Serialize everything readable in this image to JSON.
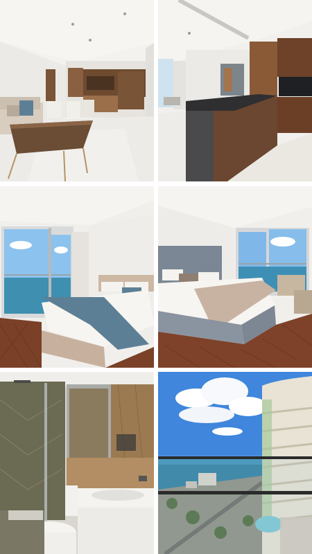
{
  "gallery": {
    "photos": [
      {
        "subject": "living-room"
      },
      {
        "subject": "kitchen"
      },
      {
        "subject": "bedroom-sea-view"
      },
      {
        "subject": "bedroom-grey-headboard"
      },
      {
        "subject": "bathroom"
      },
      {
        "subject": "balcony-sea-view"
      }
    ]
  },
  "colors": {
    "background": "#ffffff",
    "walnut": "#6e4a2f",
    "marble_floor": "#ecebe8",
    "sea": "#3f8fb0",
    "sky": "#5b9fe0",
    "herringbone": "#7a4028",
    "accent_blue": "#5d7f95"
  }
}
